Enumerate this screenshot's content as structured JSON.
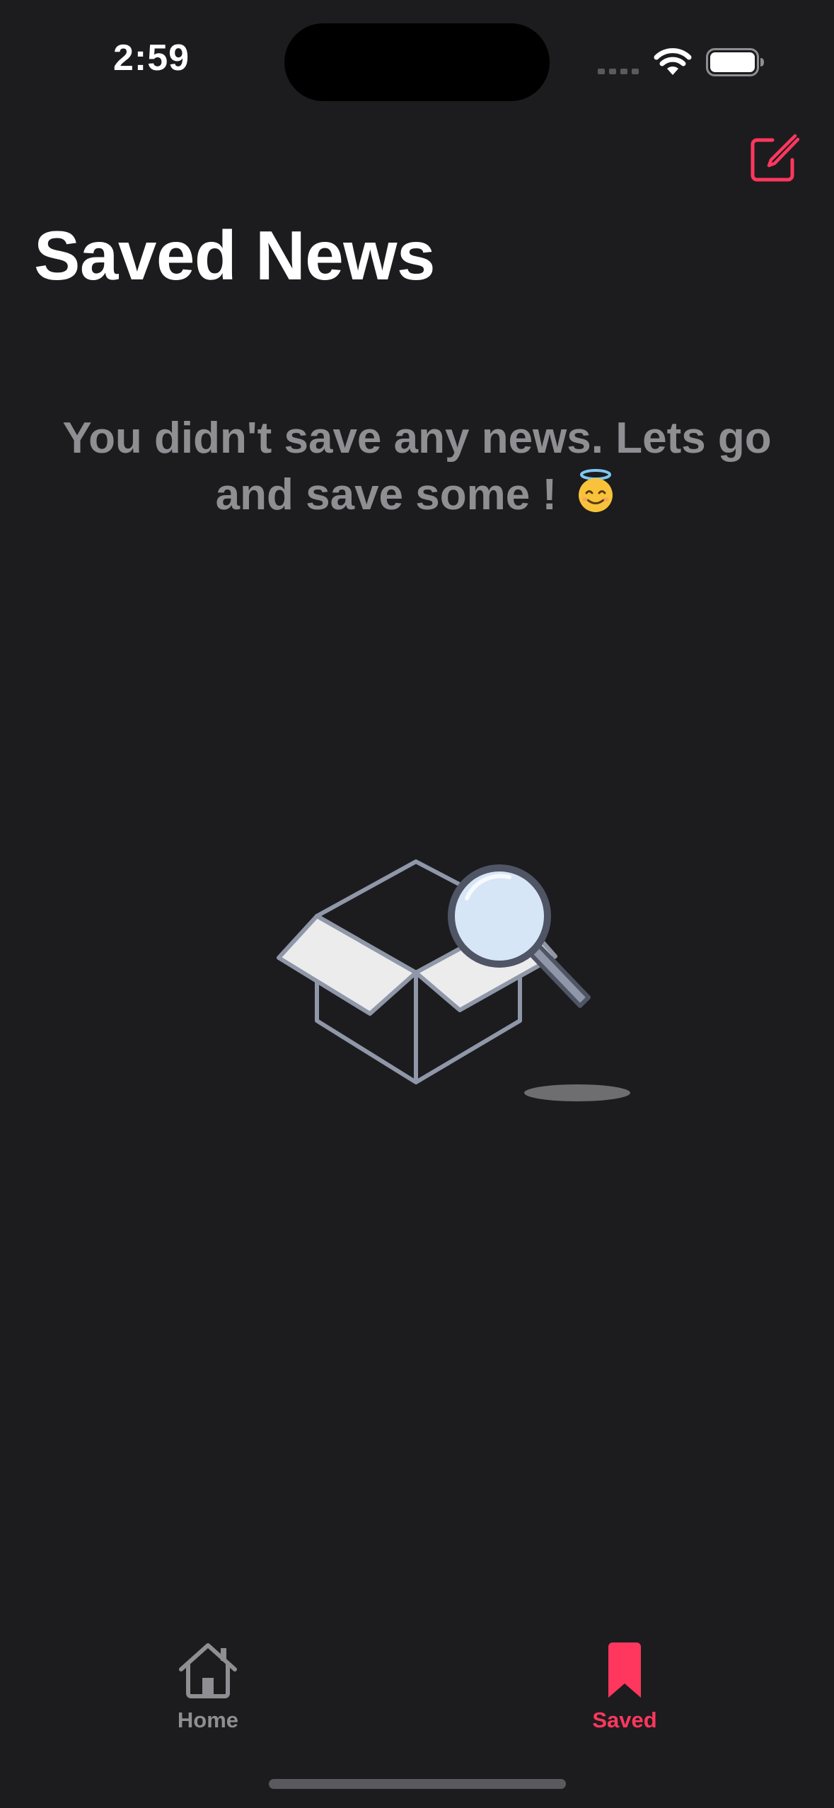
{
  "status_bar": {
    "time": "2:59"
  },
  "header": {
    "title": "Saved News",
    "compose_icon": "compose-icon"
  },
  "empty_state": {
    "message": "You didn't save any news. Lets go and save some !",
    "emoji": "smiling-face-with-halo",
    "illustration": "empty-box-magnifier"
  },
  "tab_bar": {
    "tabs": [
      {
        "label": "Home",
        "icon": "house-icon",
        "selected": false
      },
      {
        "label": "Saved",
        "icon": "bookmark-icon",
        "selected": true
      }
    ]
  },
  "colors": {
    "background": "#1c1c1e",
    "accent": "#ff375f",
    "secondary_text": "#8e8e93",
    "primary_text": "#ffffff"
  }
}
